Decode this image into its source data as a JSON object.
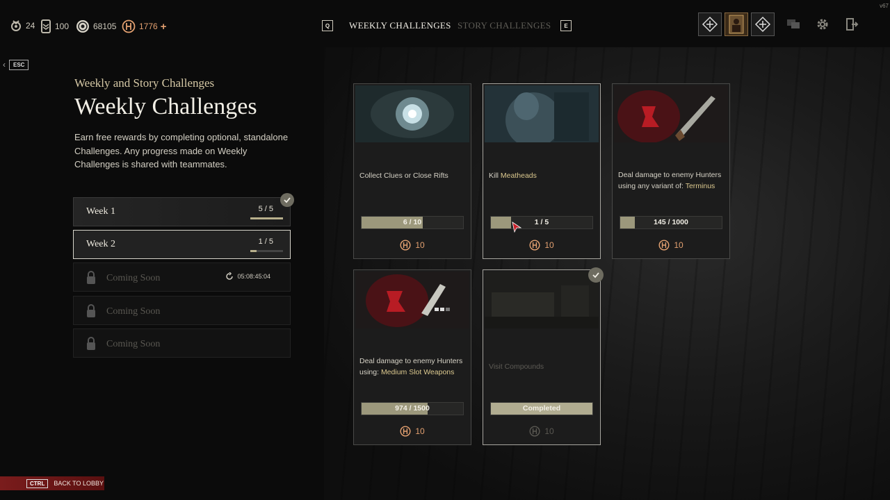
{
  "version": "v67",
  "currencies": [
    {
      "icon": "medal-icon",
      "value": "24"
    },
    {
      "icon": "rank-icon",
      "value": "100"
    },
    {
      "icon": "hunt-dollars-icon",
      "value": "68105"
    },
    {
      "icon": "blood-bonds-icon",
      "value": "1776",
      "plus": "+"
    }
  ],
  "tabs": {
    "left_key": "Q",
    "weekly": "WEEKLY CHALLENGES",
    "story": "STORY CHALLENGES",
    "right_key": "E"
  },
  "esc_label": "ESC",
  "subtitle": "Weekly and Story Challenges",
  "title": "Weekly Challenges",
  "description": "Earn free rewards by completing optional, standalone Challenges. Any progress made on Weekly Challenges is shared with teammates.",
  "weeks": [
    {
      "label": "Week 1",
      "count": "5 / 5",
      "progress": 1.0,
      "completed": true
    },
    {
      "label": "Week 2",
      "count": "1 / 5",
      "progress": 0.2,
      "selected": true
    }
  ],
  "locked": [
    {
      "label": "Coming Soon",
      "timer": "05:08:45:04"
    },
    {
      "label": "Coming Soon"
    },
    {
      "label": "Coming Soon"
    }
  ],
  "cards": [
    {
      "text": "Collect Clues or Close Rifts",
      "highlight": "",
      "progress_text": "6 / 10",
      "progress": 0.6,
      "reward": "10"
    },
    {
      "text": "Kill ",
      "highlight": "Meatheads",
      "progress_text": "1 / 5",
      "progress": 0.2,
      "reward": "10"
    },
    {
      "text": "Deal damage to enemy Hunters using any variant of: ",
      "highlight": "Terminus",
      "progress_text": "145 / 1000",
      "progress": 0.145,
      "reward": "10"
    },
    {
      "text": "Deal damage to enemy Hunters using: ",
      "highlight": "Medium Slot Weapons",
      "progress_text": "974 / 1500",
      "progress": 0.65,
      "reward": "10"
    },
    {
      "text": "Visit Compounds",
      "highlight": "",
      "progress_text": "Completed",
      "progress": 1.0,
      "reward": "10",
      "completed": true
    }
  ],
  "back": {
    "key": "CTRL",
    "label": "BACK TO LOBBY"
  }
}
